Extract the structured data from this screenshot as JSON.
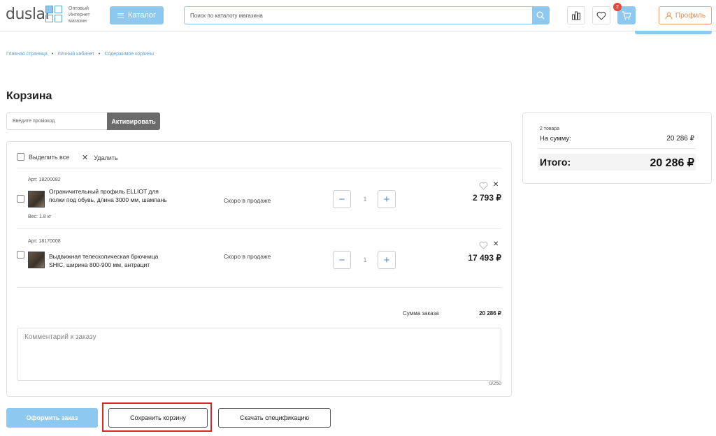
{
  "header": {
    "logo_text": "duslar",
    "logo_sub": [
      "Оптовый",
      "Интернет",
      "магазин"
    ],
    "catalog_label": "Каталог",
    "search_placeholder": "Поиск по каталогу магазина",
    "cart_badge": "2",
    "profile_label": "Профиль",
    "accent_color": "#8cc8f0",
    "profile_color": "#e8894a"
  },
  "breadcrumb": [
    "Главная страница",
    "Личный кабинет",
    "Содержимое корзины"
  ],
  "page_title": "Корзина",
  "promo": {
    "placeholder": "Введите промокод",
    "button_label": "Активировать"
  },
  "cart": {
    "select_all_label": "Выделить все",
    "delete_label": "Удалить",
    "items": [
      {
        "article": "Арт: 18200082",
        "name": "Ограничительный профиль ELLIOT для полки под обувь, длина 3000 мм, шампань",
        "weight": "Вес: 1.8 кг",
        "status": "Скоро в продаже",
        "quantity": "1",
        "price": "2 793 ₽"
      },
      {
        "article": "Арт: 18170008",
        "name": "Выдвижная телескопическая брючница SHIC, ширина 800-900 мм, антрацит",
        "weight": "",
        "status": "Скоро в продаже",
        "quantity": "1",
        "price": "17 493 ₽"
      }
    ],
    "order_sum_label": "Сумма заказа",
    "order_sum_value": "20 286 ₽",
    "comment_placeholder": "Комментарий к заказу",
    "comment_counter": "0/250"
  },
  "summary": {
    "count_label": "2 товара",
    "sum_label": "На сумму:",
    "sum_value": "20 286 ₽",
    "total_label": "Итого:",
    "total_value": "20 286 ₽"
  },
  "actions": {
    "order_label": "Оформить заказ",
    "save_label": "Сохранить корзину",
    "spec_label": "Скачать спецификацию",
    "highlight_color": "#d9252b"
  }
}
